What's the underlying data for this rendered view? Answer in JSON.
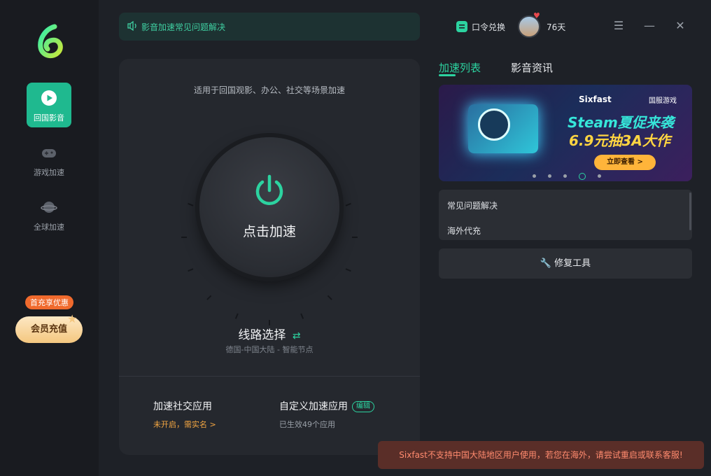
{
  "sidebar": {
    "items": [
      {
        "label": "回国影音",
        "icon": "play-icon",
        "active": true
      },
      {
        "label": "游戏加速",
        "icon": "gamepad-icon",
        "active": false
      },
      {
        "label": "全球加速",
        "icon": "planet-icon",
        "active": false
      }
    ],
    "vip_badge": "首充享优惠",
    "vip_button": "会员充值"
  },
  "notice": {
    "text": "影音加速常见问题解决",
    "icon": "speaker-icon"
  },
  "topbar": {
    "coupon_label": "口令兑换",
    "days_label": "76天",
    "menu_icon": "menu-icon",
    "minimize_icon": "minimize-icon",
    "close_icon": "close-icon"
  },
  "main": {
    "subtitle": "适用于回国观影、办公、社交等场景加速",
    "power_label": "点击加速",
    "route_title": "线路选择",
    "route_detail": "德国-中国大陆 - 智能节点",
    "features": [
      {
        "title": "加速社交应用",
        "status": "未开启，需实名 >",
        "tag": ""
      },
      {
        "title": "自定义加速应用",
        "status": "已生效49个应用",
        "tag": "编辑"
      }
    ]
  },
  "right": {
    "tabs": [
      {
        "label": "加速列表",
        "active": true
      },
      {
        "label": "影音资讯",
        "active": false
      }
    ],
    "banner": {
      "brand": "Sixfast",
      "partner": "国服游戏",
      "headline1": "Steam夏促来袭",
      "headline2": "6.9元抽3A大作",
      "cta": "立即查看 >",
      "dot_count": 5,
      "active_dot": 4
    },
    "faq": [
      "常见问题解决",
      "海外代充"
    ],
    "repair_label": "修复工具"
  },
  "toast": "Sixfast不支持中国大陆地区用户使用，若您在海外，请尝试重启或联系客服!",
  "colors": {
    "accent": "#2cd3a0",
    "bg": "#1e2127",
    "card": "#25282e",
    "warning": "#ff8a6e"
  }
}
